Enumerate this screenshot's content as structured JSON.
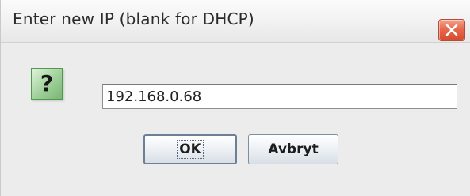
{
  "dialog": {
    "title": "Enter new IP (blank for DHCP)",
    "close_icon": "close-icon"
  },
  "prompt": {
    "icon": "question-icon",
    "icon_glyph": "?",
    "input_value": "192.168.0.68"
  },
  "buttons": {
    "ok_label": "OK",
    "cancel_label": "Avbryt"
  },
  "colors": {
    "close_button": "#e05a3d",
    "question_icon": "#8fc98a"
  }
}
